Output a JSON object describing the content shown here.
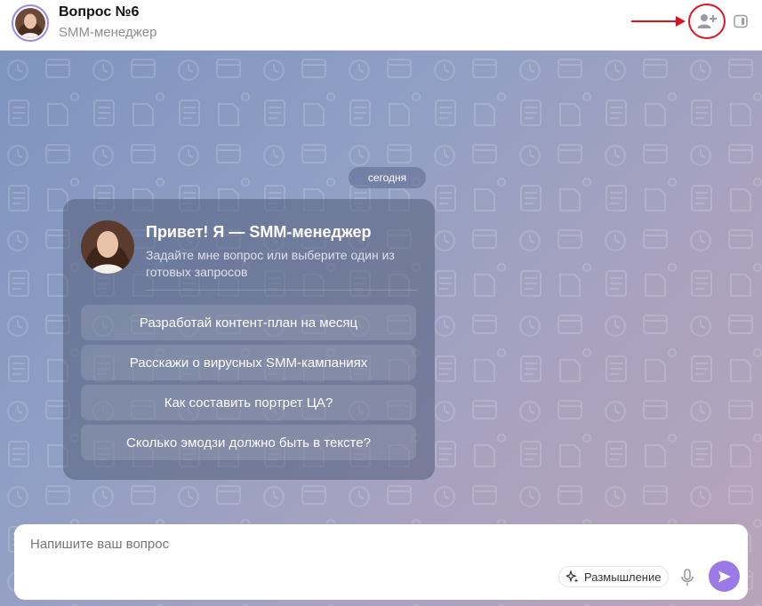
{
  "header": {
    "title": "Вопрос №6",
    "subtitle": "SMM-менеджер",
    "add_user_icon": "add-user-icon",
    "panel_icon": "side-panel-icon"
  },
  "chat": {
    "date_label": "сегодня",
    "greeting": {
      "title": "Привет! Я — SMM-менеджер",
      "subtitle": "Задайте мне вопрос или выберите один из готовых запросов"
    },
    "suggestions": [
      "Разработай контент-план на месяц",
      "Расскажи о вирусных SMM-кампаниях",
      "Как составить портрет ЦА?",
      "Сколько эмодзи должно быть в тексте?"
    ]
  },
  "composer": {
    "placeholder": "Напишите ваш вопрос",
    "think_label": "Размышление",
    "mic_icon": "microphone-icon",
    "send_icon": "send-icon",
    "accent_color": "#9b7ae8"
  }
}
